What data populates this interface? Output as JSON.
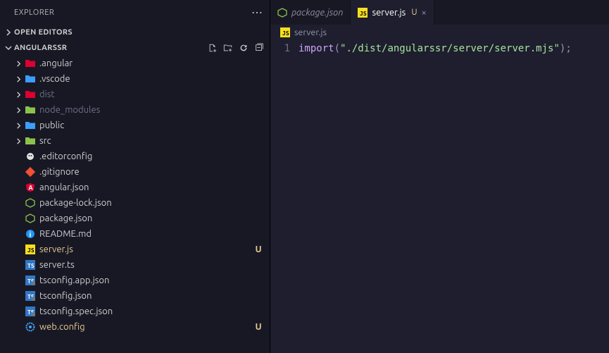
{
  "sidebar": {
    "title": "EXPLORER",
    "sections": {
      "openEditors": {
        "label": "OPEN EDITORS",
        "expanded": false
      },
      "project": {
        "label": "ANGULARSSR",
        "expanded": true,
        "toolbar": {
          "newFile": "New File",
          "newFolder": "New Folder",
          "refresh": "Refresh",
          "collapse": "Collapse"
        }
      }
    }
  },
  "tree": [
    {
      "type": "folder",
      "name": ".angular",
      "expanded": false,
      "iconColor": "#DD0031",
      "dim": false
    },
    {
      "type": "folder",
      "name": ".vscode",
      "expanded": false,
      "iconColor": "#3b9eff",
      "dim": false
    },
    {
      "type": "folder",
      "name": "dist",
      "expanded": false,
      "iconColor": "#DD0031",
      "dim": true
    },
    {
      "type": "folder",
      "name": "node_modules",
      "expanded": false,
      "iconColor": "#8bc34a",
      "dim": true
    },
    {
      "type": "folder",
      "name": "public",
      "expanded": false,
      "iconColor": "#3b9eff",
      "dim": false
    },
    {
      "type": "folder",
      "name": "src",
      "expanded": false,
      "iconColor": "#8bc34a",
      "dim": false
    },
    {
      "type": "file",
      "name": ".editorconfig",
      "icon": "editorconfig",
      "iconColor": "#e2e2e2"
    },
    {
      "type": "file",
      "name": ".gitignore",
      "icon": "git",
      "iconColor": "#f05133"
    },
    {
      "type": "file",
      "name": "angular.json",
      "icon": "angular",
      "iconColor": "#DD0031"
    },
    {
      "type": "file",
      "name": "package-lock.json",
      "icon": "nodejs",
      "iconColor": "#8bc34a"
    },
    {
      "type": "file",
      "name": "package.json",
      "icon": "nodejs",
      "iconColor": "#8bc34a"
    },
    {
      "type": "file",
      "name": "README.md",
      "icon": "info",
      "iconColor": "#2196f3"
    },
    {
      "type": "file",
      "name": "server.js",
      "icon": "js",
      "iconColor": "#f7df1e",
      "status": "U",
      "modified": true,
      "active": true
    },
    {
      "type": "file",
      "name": "server.ts",
      "icon": "ts",
      "iconColor": "#3178c6"
    },
    {
      "type": "file",
      "name": "tsconfig.app.json",
      "icon": "tsconfig",
      "iconColor": "#3178c6"
    },
    {
      "type": "file",
      "name": "tsconfig.json",
      "icon": "tsconfig",
      "iconColor": "#3178c6"
    },
    {
      "type": "file",
      "name": "tsconfig.spec.json",
      "icon": "tsconfig",
      "iconColor": "#3178c6"
    },
    {
      "type": "file",
      "name": "web.config",
      "icon": "gear",
      "iconColor": "#42a5f5",
      "status": "U",
      "modified": true
    }
  ],
  "tabs": [
    {
      "label": "package.json",
      "icon": "nodejs",
      "iconColor": "#8bc34a",
      "status": "",
      "active": false,
      "preview": true
    },
    {
      "label": "server.js",
      "icon": "js",
      "iconColor": "#f7df1e",
      "status": "U",
      "active": true,
      "preview": false
    }
  ],
  "breadcrumb": {
    "icon": "js",
    "iconColor": "#f7df1e",
    "label": "server.js"
  },
  "editor": {
    "lines": [
      {
        "num": "1",
        "tokens": [
          {
            "t": "import",
            "c": "kw"
          },
          {
            "t": "(",
            "c": "punc"
          },
          {
            "t": "\"./dist/angularssr/server/server.mjs\"",
            "c": "str"
          },
          {
            "t": ")",
            "c": "punc"
          },
          {
            "t": ";",
            "c": "punc"
          }
        ]
      }
    ]
  }
}
